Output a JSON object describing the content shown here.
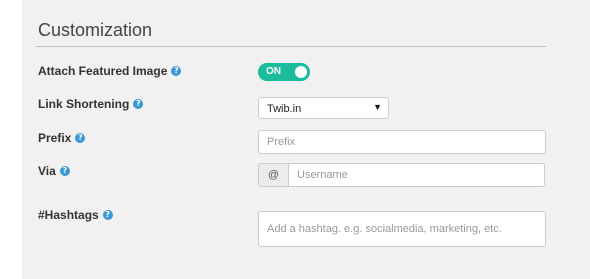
{
  "section": {
    "title": "Customization"
  },
  "fields": {
    "featured_image": {
      "label": "Attach Featured Image",
      "help": "?",
      "toggle_text": "ON",
      "toggle_on": true
    },
    "link_shortening": {
      "label": "Link Shortening",
      "help": "?",
      "selected": "Twib.in",
      "caret": "▼"
    },
    "prefix": {
      "label": "Prefix",
      "help": "?",
      "placeholder": "Prefix",
      "value": ""
    },
    "via": {
      "label": "Via",
      "help": "?",
      "addon": "@",
      "placeholder": "Username",
      "value": ""
    },
    "hashtags": {
      "label": "#Hashtags",
      "help": "?",
      "placeholder": "Add a hashtag. e.g. socialmedia, marketing, etc.",
      "value": ""
    }
  },
  "colors": {
    "toggle_on": "#1abc9c",
    "help_icon": "#3b97d3",
    "panel_bg": "#f1f1f1"
  }
}
